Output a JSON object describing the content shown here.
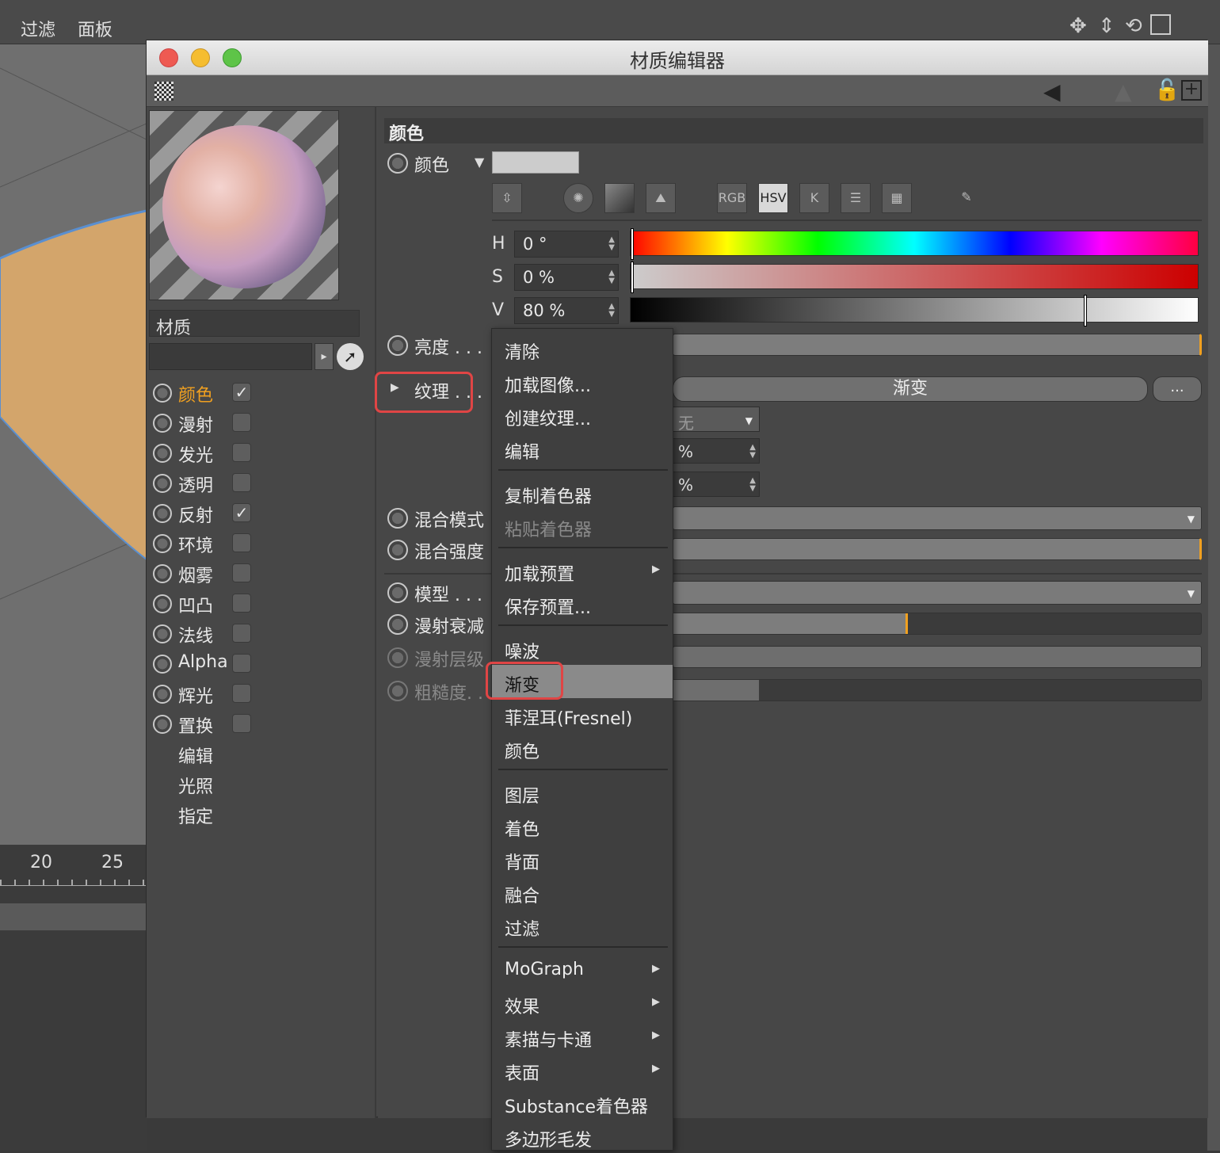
{
  "app_menu": [
    "过滤",
    "面板"
  ],
  "timeline": {
    "ticks": [
      "20",
      "25"
    ]
  },
  "window": {
    "title": "材质编辑器"
  },
  "material": {
    "name": "材质"
  },
  "channels": [
    {
      "label": "颜色",
      "checked": true,
      "active": true,
      "radio": true
    },
    {
      "label": "漫射",
      "checked": false,
      "radio": true
    },
    {
      "label": "发光",
      "checked": false,
      "radio": true
    },
    {
      "label": "透明",
      "checked": false,
      "radio": true
    },
    {
      "label": "反射",
      "checked": true,
      "radio": true
    },
    {
      "label": "环境",
      "checked": false,
      "radio": true
    },
    {
      "label": "烟雾",
      "checked": false,
      "radio": true
    },
    {
      "label": "凹凸",
      "checked": false,
      "radio": true
    },
    {
      "label": "法线",
      "checked": false,
      "radio": true
    },
    {
      "label": "Alpha",
      "checked": false,
      "radio": true
    },
    {
      "label": "辉光",
      "checked": false,
      "radio": true
    },
    {
      "label": "置换",
      "checked": false,
      "radio": true
    },
    {
      "label": "编辑",
      "radio": false
    },
    {
      "label": "光照",
      "radio": false
    },
    {
      "label": "指定",
      "radio": false
    }
  ],
  "section": {
    "title": "颜色"
  },
  "color": {
    "label": "颜色",
    "swatch": "#cccccc",
    "mode_buttons": [
      "RGB",
      "HSV",
      "K"
    ],
    "active_mode": "HSV",
    "h": {
      "label": "H",
      "value": "0 °",
      "level": 0.0
    },
    "s": {
      "label": "S",
      "value": "0 %",
      "level": 0.0
    },
    "v": {
      "label": "V",
      "value": "80 %",
      "level": 0.8
    }
  },
  "properties": {
    "brightness": "亮度 . . .",
    "texture": "纹理 . . .",
    "texture_value": "渐变",
    "texture_more": "...",
    "texture_none": "无",
    "pct1": "%",
    "pct2": "%",
    "blend_mode": "混合模式",
    "blend_strength": "混合强度",
    "model": "模型 . . .",
    "diffuse_falloff": "漫射衰减",
    "diffuse_level": "漫射层级",
    "roughness": "粗糙度. ."
  },
  "popup_menu": {
    "items": [
      {
        "label": "清除"
      },
      {
        "label": "加载图像..."
      },
      {
        "label": "创建纹理..."
      },
      {
        "label": "编辑"
      },
      {
        "label": "复制着色器"
      },
      {
        "label": "粘贴着色器",
        "disabled": true
      },
      {
        "label": "加载预置",
        "submenu": true
      },
      {
        "label": "保存预置..."
      },
      {
        "label": "噪波"
      },
      {
        "label": "渐变",
        "selected": true
      },
      {
        "label": "菲涅耳(Fresnel)"
      },
      {
        "label": "颜色"
      },
      {
        "label": "图层"
      },
      {
        "label": "着色"
      },
      {
        "label": "背面"
      },
      {
        "label": "融合"
      },
      {
        "label": "过滤"
      },
      {
        "label": "MoGraph",
        "submenu": true
      },
      {
        "label": "效果",
        "submenu": true
      },
      {
        "label": "素描与卡通",
        "submenu": true
      },
      {
        "label": "表面",
        "submenu": true
      },
      {
        "label": "Substance着色器"
      },
      {
        "label": "多边形毛发"
      }
    ]
  },
  "accent_color": "#f0a020",
  "highlight_color": "#e04545"
}
